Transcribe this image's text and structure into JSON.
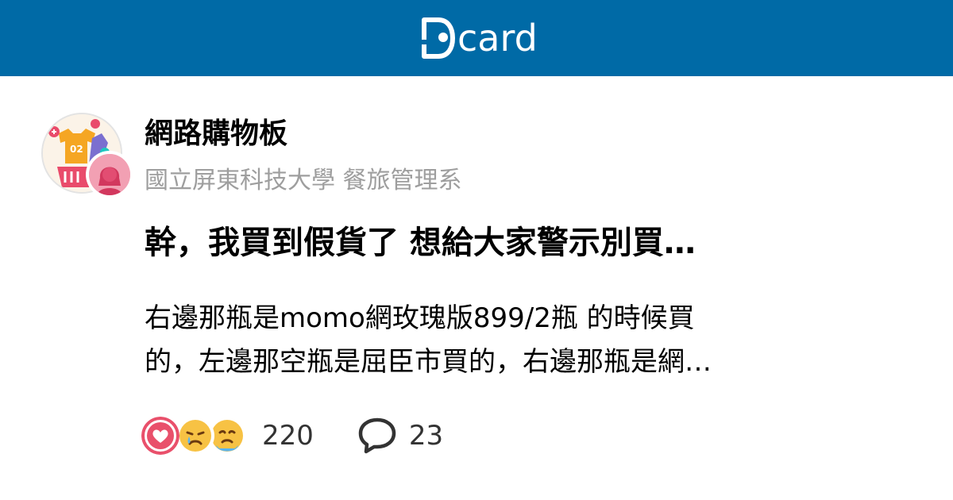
{
  "header": {
    "brand": "card",
    "brand_color": "#006aa6"
  },
  "post": {
    "forum_name": "網路購物板",
    "author_school": "國立屏東科技大學 餐旅管理系",
    "title": "幹，我買到假貨了 想給大家警示別買…",
    "excerpt_lines": [
      "右邊那瓶是momo網玫瑰版899/2瓶 的時候買",
      "的，左邊那空瓶是屈臣市買的，右邊那瓶是網…"
    ]
  },
  "stats": {
    "reactions": [
      "heart-icon",
      "crying-face-icon",
      "sad-face-icon"
    ],
    "like_count": "220",
    "comment_count": "23"
  }
}
